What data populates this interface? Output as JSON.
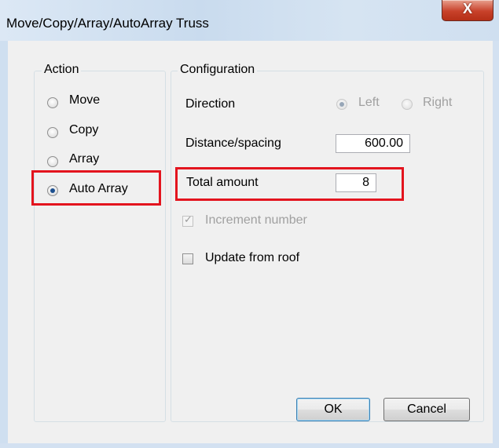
{
  "window": {
    "title": "Move/Copy/Array/AutoArray Truss",
    "close_glyph": "X"
  },
  "action": {
    "label": "Action",
    "options": [
      {
        "label": "Move",
        "checked": false
      },
      {
        "label": "Copy",
        "checked": false
      },
      {
        "label": "Array",
        "checked": false
      },
      {
        "label": "Auto Array",
        "checked": true
      }
    ]
  },
  "configuration": {
    "label": "Configuration",
    "direction_label": "Direction",
    "direction_left": "Left",
    "direction_right": "Right",
    "distance_label": "Distance/spacing",
    "distance_value": "600.00",
    "total_label": "Total amount",
    "total_value": "8",
    "increment_label": "Increment number",
    "increment_checked": true,
    "update_roof_label": "Update from roof",
    "update_roof_checked": false
  },
  "buttons": {
    "ok": "OK",
    "cancel": "Cancel"
  },
  "colors": {
    "highlight": "#e3141e",
    "title_bar": "#d3e1f1"
  }
}
